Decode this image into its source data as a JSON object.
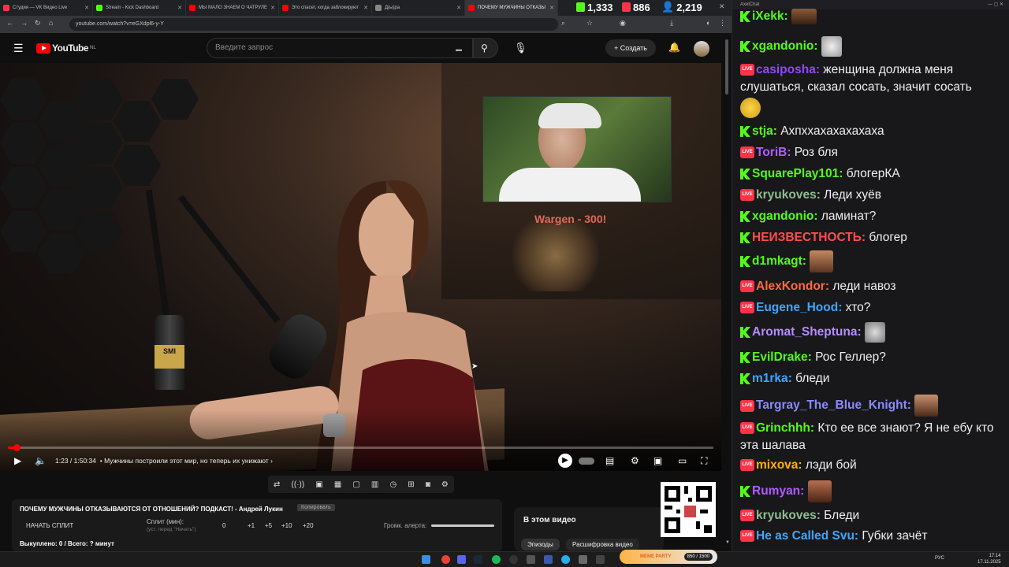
{
  "browser": {
    "tabs": [
      {
        "title": "Студия — VK Видео Live",
        "color": "#ff3347"
      },
      {
        "title": "Stream - Kick Dashboard",
        "color": "#53fc18"
      },
      {
        "title": "МЫ МАЛО ЗНАЕМ О ЧАТРУЛЕ",
        "color": "#ff0000"
      },
      {
        "title": "Это спасет, когда заблокируют",
        "color": "#ff0000"
      },
      {
        "title": "Д(ы)ра",
        "color": "#888888"
      },
      {
        "title": "ПОЧЕМУ МУЖЧИНЫ ОТКАЗЫ",
        "color": "#ff0000"
      }
    ],
    "url": "youtube.com/watch?v=eGXdpl6-y-Y"
  },
  "stats": {
    "kick_viewers": "1,333",
    "vk_viewers": "886",
    "total_viewers": "2,219"
  },
  "youtube": {
    "logo_text": "YouTube",
    "region": "NL",
    "search_placeholder": "Введите запрос",
    "create_label": "Создать"
  },
  "video": {
    "pip_caption": "Wargen  - 300!",
    "time": "1:23 / 1:50:34",
    "chapter": "• Мужчины построили этот мир, но теперь их унижают",
    "progress_fraction": 0.0125
  },
  "split": {
    "title": "ПОЧЕМУ МУЖЧИНЫ ОТКАЗЫВАЮТСЯ ОТ ОТНОШЕНИЙ? ПОДКАСТ! - Андрей Лукин",
    "copy_label": "Копировать",
    "start_label": "НАЧАТЬ СПЛИТ",
    "split_min_label": "Сплит (мин):",
    "split_hint": "(уст. перед \"Начать\")",
    "value": "0",
    "increments": [
      "+1",
      "+5",
      "+10",
      "+20"
    ],
    "alert_label": "Громк. алерта:",
    "bought": "Выкуплено: 0 / Всего: ? минут"
  },
  "side": {
    "in_video_title": "В этом видео",
    "tab_episodes": "Эпизоды",
    "tab_transcript": "Расшифровка видео"
  },
  "chat": {
    "window_title": "AxelChat",
    "messages": [
      {
        "platform": "kick",
        "nick": "iXekk",
        "color": "#53fc18",
        "text": ""
      },
      {
        "platform": "kick",
        "nick": "xgandonio",
        "color": "#53fc18",
        "text": ""
      },
      {
        "platform": "vk",
        "nick": "casiposha",
        "color": "#9147ff",
        "text": "женщина должна меня слушаться, сказал сосать, значит сосать"
      },
      {
        "platform": "kick",
        "nick": "stja",
        "color": "#53fc18",
        "text": "Ахпххахахахахаха"
      },
      {
        "platform": "vk",
        "nick": "ToriB",
        "color": "#b15cff",
        "text": "Роз бля"
      },
      {
        "platform": "kick",
        "nick": "SquarePlay101",
        "color": "#53fc18",
        "text": "блогерКА"
      },
      {
        "platform": "vk",
        "nick": "kryukoves",
        "color": "#8fbc8f",
        "text": "Леди хуёв"
      },
      {
        "platform": "kick",
        "nick": "xgandonio",
        "color": "#53fc18",
        "text": "ламинат?"
      },
      {
        "platform": "kick",
        "nick": "НЕИЗВЕСТНОСТЬ",
        "color": "#ff4d4d",
        "text": "блогер"
      },
      {
        "platform": "kick",
        "nick": "d1mkagt",
        "color": "#53fc18",
        "text": ""
      },
      {
        "platform": "vk",
        "nick": "AlexKondor",
        "color": "#ff6a3d",
        "text": "леди навоз"
      },
      {
        "platform": "vk",
        "nick": "Eugene_Hood",
        "color": "#3ea6ff",
        "text": "хто?"
      },
      {
        "platform": "kick",
        "nick": "Aromat_Sheptuna",
        "color": "#b78cff",
        "text": ""
      },
      {
        "platform": "kick",
        "nick": "EvilDrake",
        "color": "#53fc18",
        "text": "Рос Геллер?"
      },
      {
        "platform": "kick",
        "nick": "m1rka",
        "color": "#3ea6ff",
        "text": "бледи"
      },
      {
        "platform": "vk",
        "nick": "Targray_The_Blue_Knight",
        "color": "#8a8aff",
        "text": ""
      },
      {
        "platform": "vk",
        "nick": "Grinchhh",
        "color": "#53fc18",
        "text": "Кто ее все знают? Я не ебу кто эта шалава"
      },
      {
        "platform": "vk",
        "nick": "mixova",
        "color": "#ffb000",
        "text": "лэди бой"
      },
      {
        "platform": "kick",
        "nick": "Rumyan",
        "color": "#b15cff",
        "text": ""
      },
      {
        "platform": "vk",
        "nick": "kryukoves",
        "color": "#8fbc8f",
        "text": "Бледи"
      },
      {
        "platform": "vk",
        "nick": "He as Called Svu",
        "color": "#3ea6ff",
        "text": "Губки зачёт"
      }
    ]
  },
  "taskbar": {
    "lang": "РУС",
    "time": "17:14",
    "date": "17.11.2025",
    "widget": "MEME PARTY",
    "widget_value": "850 / 1500"
  }
}
